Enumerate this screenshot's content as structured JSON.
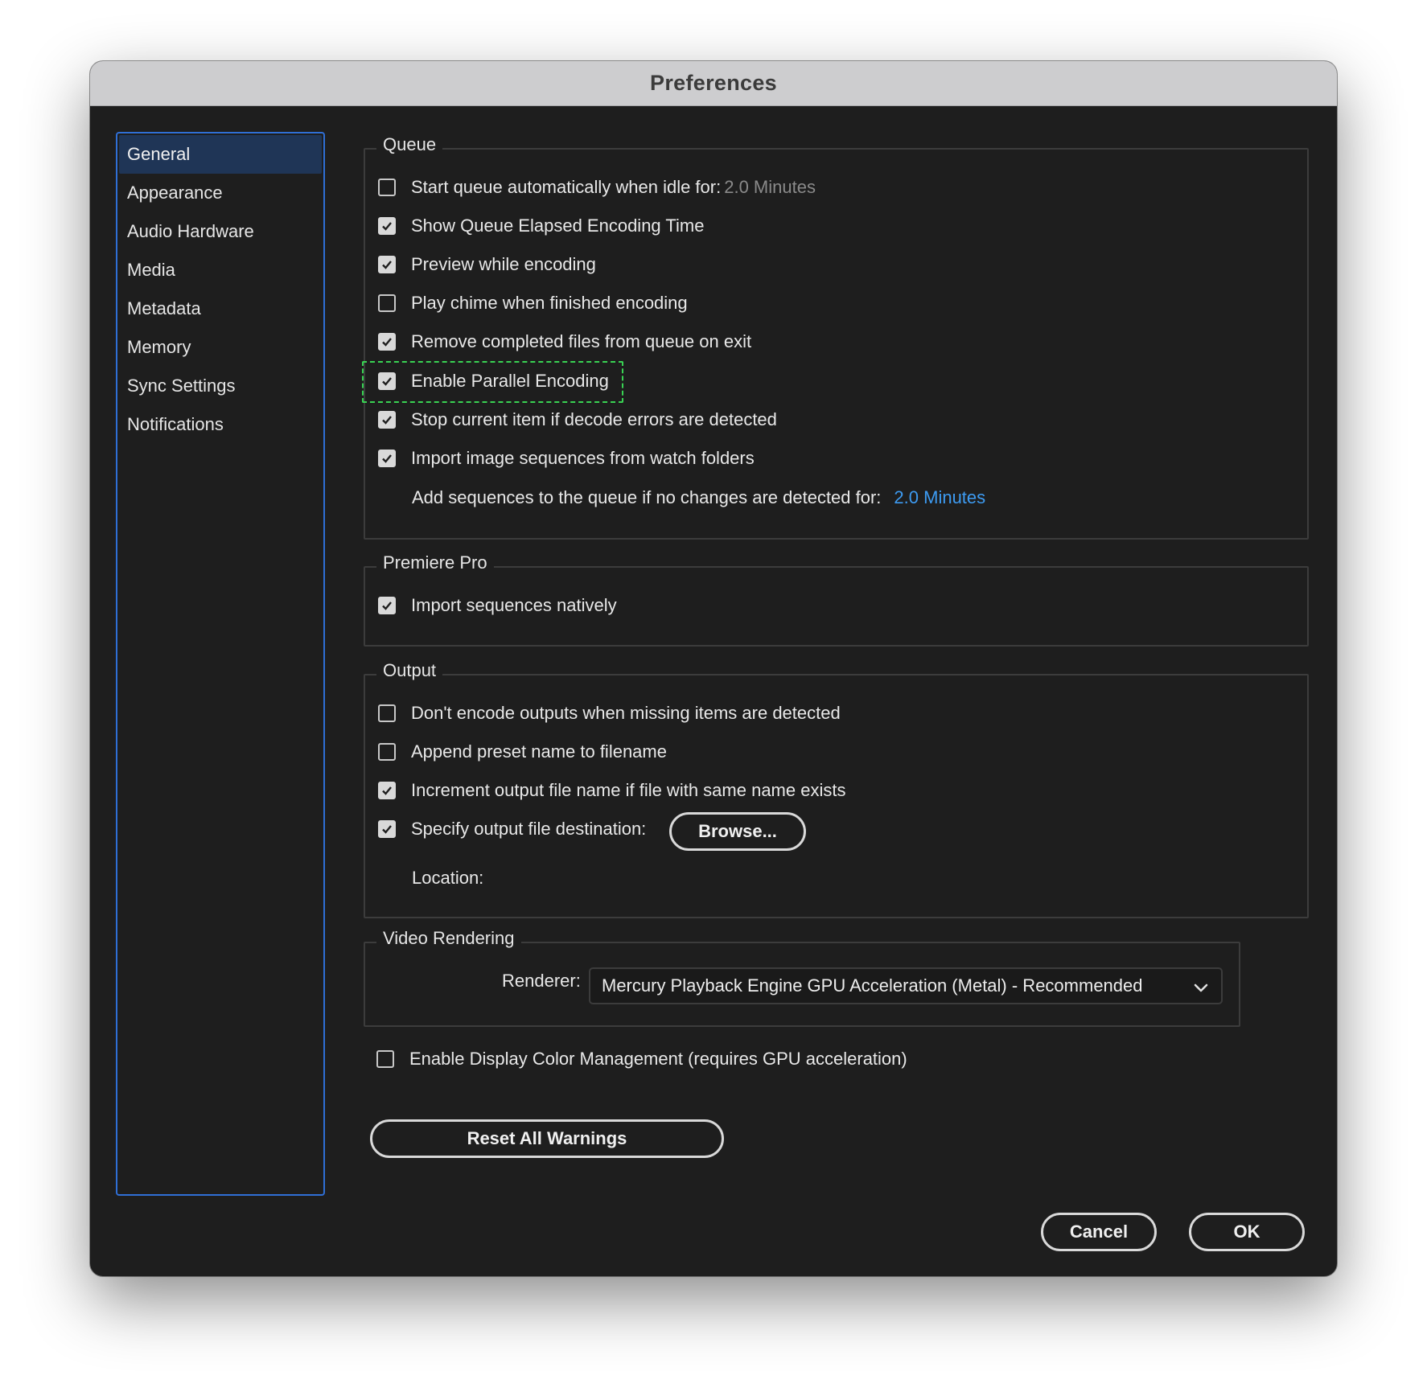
{
  "window": {
    "title": "Preferences"
  },
  "sidebar": {
    "items": [
      {
        "label": "General",
        "active": true
      },
      {
        "label": "Appearance"
      },
      {
        "label": "Audio Hardware"
      },
      {
        "label": "Media"
      },
      {
        "label": "Metadata"
      },
      {
        "label": "Memory"
      },
      {
        "label": "Sync Settings"
      },
      {
        "label": "Notifications"
      }
    ]
  },
  "queue": {
    "legend": "Queue",
    "items": [
      {
        "label": "Start queue automatically when idle for:",
        "checked": false,
        "value": "2.0 Minutes"
      },
      {
        "label": "Show Queue Elapsed Encoding Time",
        "checked": true
      },
      {
        "label": "Preview while encoding",
        "checked": true
      },
      {
        "label": "Play chime when finished encoding",
        "checked": false
      },
      {
        "label": "Remove completed files from queue on exit",
        "checked": true
      },
      {
        "label": "Enable Parallel Encoding",
        "checked": true
      },
      {
        "label": "Stop current item if decode errors are detected",
        "checked": true
      },
      {
        "label": "Import image sequences from watch folders",
        "checked": true
      }
    ],
    "add_sequences_label": "Add sequences to the queue if no changes are detected for:",
    "add_sequences_value": "2.0 Minutes"
  },
  "premiere": {
    "legend": "Premiere Pro",
    "items": [
      {
        "label": "Import sequences natively",
        "checked": true
      }
    ]
  },
  "output": {
    "legend": "Output",
    "items": [
      {
        "label": "Don't encode outputs when missing items are detected",
        "checked": false
      },
      {
        "label": "Append preset name to filename",
        "checked": false
      },
      {
        "label": "Increment output file name if file with same name exists",
        "checked": true
      },
      {
        "label": "Specify output file destination:",
        "checked": true
      }
    ],
    "browse_label": "Browse...",
    "location_label": "Location:"
  },
  "video_rendering": {
    "legend": "Video Rendering",
    "renderer_label": "Renderer:",
    "renderer_value": "Mercury Playback Engine GPU Acceleration (Metal) - Recommended"
  },
  "color_management": {
    "label": "Enable Display Color Management (requires GPU acceleration)",
    "checked": false
  },
  "reset_label": "Reset All Warnings",
  "footer": {
    "cancel_label": "Cancel",
    "ok_label": "OK"
  },
  "colors": {
    "accent": "#2f6fd6",
    "link": "#3d9bf2",
    "highlight": "#39d353",
    "background": "#1e1e1e"
  },
  "icons": {
    "checkbox_check": "checkmark-icon",
    "select_chevron": "chevron-down-icon"
  }
}
